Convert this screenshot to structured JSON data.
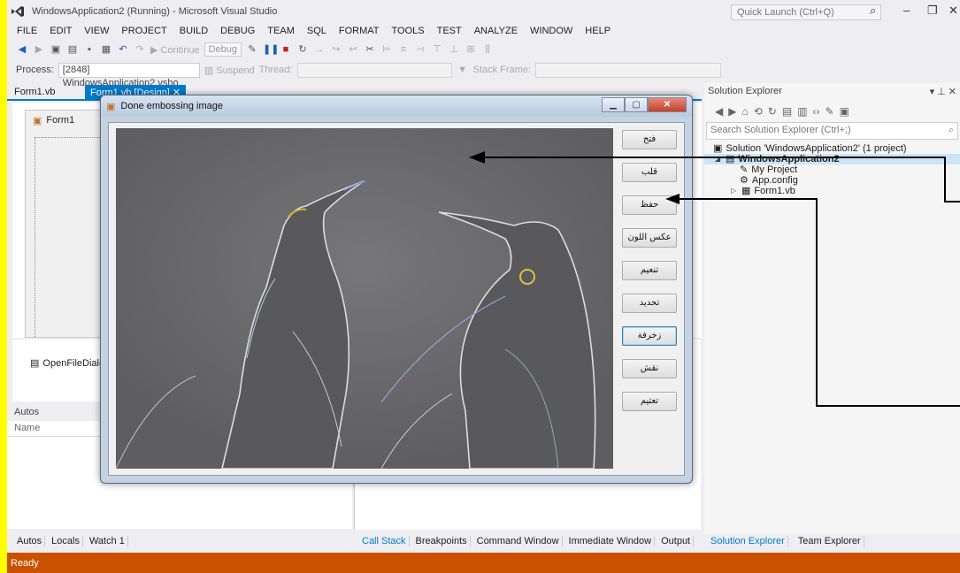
{
  "ide": {
    "title": "WindowsApplication2 (Running) - Microsoft Visual Studio",
    "quick_launch_placeholder": "Quick Launch (Ctrl+Q)",
    "menu": [
      "FILE",
      "EDIT",
      "VIEW",
      "PROJECT",
      "BUILD",
      "DEBUG",
      "TEAM",
      "SQL",
      "FORMAT",
      "TOOLS",
      "TEST",
      "ANALYZE",
      "WINDOW",
      "HELP"
    ],
    "toolbar": {
      "continue_label": "Continue",
      "config_value": "Debug",
      "process_label": "Process:",
      "process_value": "[2848] WindowsApplication2.vsho",
      "suspend_label": "Suspend",
      "thread_label": "Thread:",
      "stack_frame_label": "Stack Frame:"
    },
    "doc_tabs": [
      "Form1.vb",
      "Form1.vb [Design]"
    ],
    "designer_form_title": "Form1",
    "tray_component": "OpenFileDialog1",
    "autos": {
      "title": "Autos",
      "col_name": "Name"
    },
    "bottom_tabs_left": [
      "Autos",
      "Locals",
      "Watch 1"
    ],
    "bottom_tabs_mid": [
      "Call Stack",
      "Breakpoints",
      "Command Window",
      "Immediate Window",
      "Output"
    ],
    "solution_explorer": {
      "title": "Solution Explorer",
      "search_placeholder": "Search Solution Explorer (Ctrl+;)",
      "tree": [
        "Solution 'WindowsApplication2' (1 project)",
        "WindowsApplication2",
        "My Project",
        "App.config",
        "Form1.vb"
      ],
      "bottom_tabs": [
        "Solution Explorer",
        "Team Explorer"
      ]
    },
    "status": "Ready"
  },
  "app_window": {
    "title": "Done embossing image",
    "buttons": [
      "فتح",
      "قلب",
      "حفظ",
      "عكس اللون",
      "تنعيم",
      "تحديد",
      "زخرفة",
      "نقش",
      "تعتيم"
    ]
  }
}
